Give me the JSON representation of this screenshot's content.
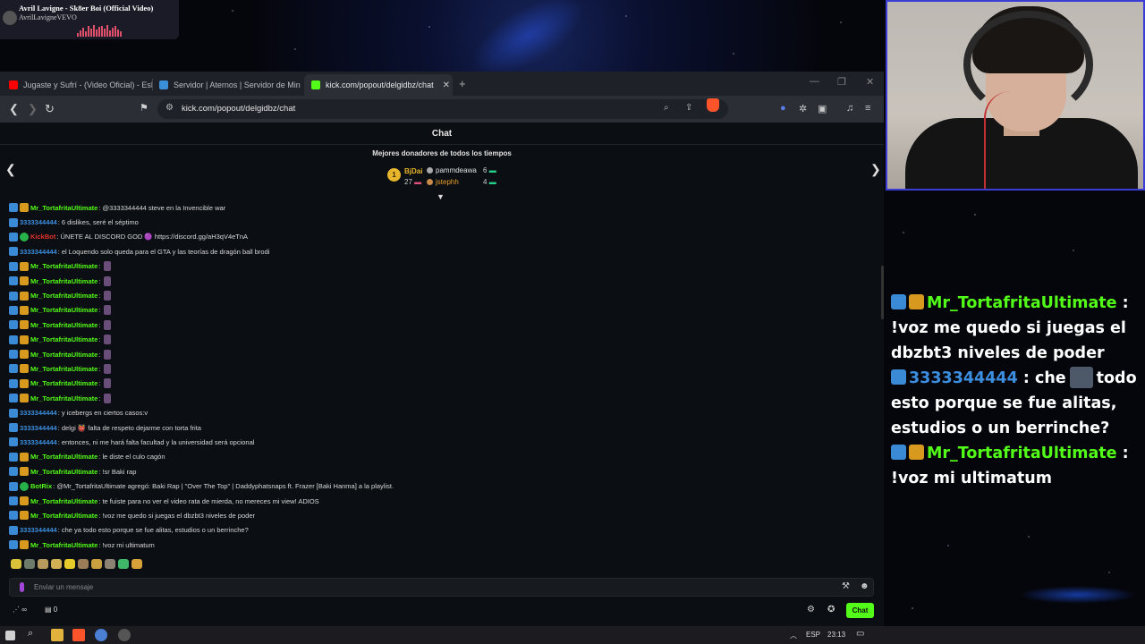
{
  "now_playing": {
    "title": "Avril Lavigne - Sk8er Boi (Official Video)",
    "channel": "AvrilLavigneVEVO"
  },
  "browser": {
    "tabs": [
      {
        "label": "Jugaste y Sufrí - (Video Oficial) - Esla",
        "favicon": "youtube-icon",
        "color": "#ff0000"
      },
      {
        "label": "Servidor | Aternos | Servidor de Mine",
        "favicon": "aternos-icon",
        "color": "#3b8ed8"
      },
      {
        "label": "kick.com/popout/delgidbz/chat",
        "favicon": "kick-icon",
        "color": "#53fc18"
      }
    ],
    "url": "kick.com/popout/delgidbz/chat"
  },
  "chat": {
    "title": "Chat",
    "top_donors_title": "Mejores donadores de todos los tiempos",
    "donors": [
      {
        "name": "BjDai",
        "count": "27",
        "rank": "1"
      },
      {
        "name": "pammdeawa",
        "count": "6"
      },
      {
        "name": "jstephh",
        "count": "4"
      }
    ],
    "messages": [
      {
        "user": "Mr_TortafritaUltimate",
        "color": "#53fc18",
        "badges": [
          "blue",
          "gold"
        ],
        "text": ": @3333344444 steve en la Invencible war"
      },
      {
        "user": "3333344444",
        "color": "#3c8fe0",
        "badges": [
          "blue"
        ],
        "text": ": 6 dislikes, seré el séptimo"
      },
      {
        "user": "KickBot",
        "color": "#e0312b",
        "badges": [
          "blue",
          "green"
        ],
        "text": ": ÚNETE AL DISCORD GOD 🟣 https://discord.gg/aH3qV4eTnA"
      },
      {
        "user": "3333344444",
        "color": "#3c8fe0",
        "badges": [
          "blue"
        ],
        "text": ": el Loquendo solo queda para el GTA y las teorías de dragón ball brodi"
      },
      {
        "user": "Mr_TortafritaUltimate",
        "color": "#53fc18",
        "badges": [
          "blue",
          "gold"
        ],
        "text": ":",
        "emote": true
      },
      {
        "user": "Mr_TortafritaUltimate",
        "color": "#53fc18",
        "badges": [
          "blue",
          "gold"
        ],
        "text": ":",
        "emote": true
      },
      {
        "user": "Mr_TortafritaUltimate",
        "color": "#53fc18",
        "badges": [
          "blue",
          "gold"
        ],
        "text": ":",
        "emote": true
      },
      {
        "user": "Mr_TortafritaUltimate",
        "color": "#53fc18",
        "badges": [
          "blue",
          "gold"
        ],
        "text": ":",
        "emote": true
      },
      {
        "user": "Mr_TortafritaUltimate",
        "color": "#53fc18",
        "badges": [
          "blue",
          "gold"
        ],
        "text": ":",
        "emote": true
      },
      {
        "user": "Mr_TortafritaUltimate",
        "color": "#53fc18",
        "badges": [
          "blue",
          "gold"
        ],
        "text": ":",
        "emote": true
      },
      {
        "user": "Mr_TortafritaUltimate",
        "color": "#53fc18",
        "badges": [
          "blue",
          "gold"
        ],
        "text": ":",
        "emote": true
      },
      {
        "user": "Mr_TortafritaUltimate",
        "color": "#53fc18",
        "badges": [
          "blue",
          "gold"
        ],
        "text": ":",
        "emote": true
      },
      {
        "user": "Mr_TortafritaUltimate",
        "color": "#53fc18",
        "badges": [
          "blue",
          "gold"
        ],
        "text": ":",
        "emote": true
      },
      {
        "user": "Mr_TortafritaUltimate",
        "color": "#53fc18",
        "badges": [
          "blue",
          "gold"
        ],
        "text": ":",
        "emote": true
      },
      {
        "user": "3333344444",
        "color": "#3c8fe0",
        "badges": [
          "blue"
        ],
        "text": ": y icebergs en ciertos casos:v"
      },
      {
        "user": "3333344444",
        "color": "#3c8fe0",
        "badges": [
          "blue"
        ],
        "text": ": delgi 👹 falta de respeto dejarme con torta frita"
      },
      {
        "user": "3333344444",
        "color": "#3c8fe0",
        "badges": [
          "blue"
        ],
        "text": ": entonces, ni me hará falta facultad y la universidad será opcional"
      },
      {
        "user": "Mr_TortafritaUltimate",
        "color": "#53fc18",
        "badges": [
          "blue",
          "gold"
        ],
        "text": ": le diste el culo cagón"
      },
      {
        "user": "Mr_TortafritaUltimate",
        "color": "#53fc18",
        "badges": [
          "blue",
          "gold"
        ],
        "text": ": !sr Baki rap"
      },
      {
        "user": "BotRix",
        "color": "#53fc18",
        "badges": [
          "blue",
          "green"
        ],
        "text": ": @Mr_TortafritaUltimate agregó: Baki Rap | \"Over The Top\" | Daddyphatsnaps ft. Frazer [Baki Hanma] a la playlist."
      },
      {
        "user": "Mr_TortafritaUltimate",
        "color": "#53fc18",
        "badges": [
          "blue",
          "gold"
        ],
        "text": ": te fuiste para no ver el video rata de mierda, no mereces mi view! ADIOS"
      },
      {
        "user": "Mr_TortafritaUltimate",
        "color": "#53fc18",
        "badges": [
          "blue",
          "gold"
        ],
        "text": ": !voz me quedo si juegas el dbzbt3 niveles de poder"
      },
      {
        "user": "3333344444",
        "color": "#3c8fe0",
        "badges": [
          "blue"
        ],
        "text": ": che ya todo esto porque se fue alitas, estudios o un berrinche?"
      },
      {
        "user": "Mr_TortafritaUltimate",
        "color": "#53fc18",
        "badges": [
          "blue",
          "gold"
        ],
        "text": ": !voz mi ultimatum"
      }
    ],
    "input_placeholder": "Enviar un mensaje",
    "viewer_count": "∞",
    "gift_count": "0",
    "chat_button": "Chat"
  },
  "overlay_chat": [
    {
      "user": "Mr_TortafritaUltimate",
      "color": "#53fc18",
      "sep": " :",
      "text": "!voz me quedo si juegas el dbzbt3 niveles de poder"
    },
    {
      "user": "3333344444",
      "color": "#3c8fe0",
      "sep": " : che",
      "text": "todo esto porque se fue alitas, estudios o un berrinche?"
    },
    {
      "user": "Mr_TortafritaUltimate",
      "color": "#53fc18",
      "sep": " :",
      "text": "!voz mi ultimatum"
    }
  ],
  "taskbar": {
    "language": "ESP",
    "time": "23:13"
  }
}
